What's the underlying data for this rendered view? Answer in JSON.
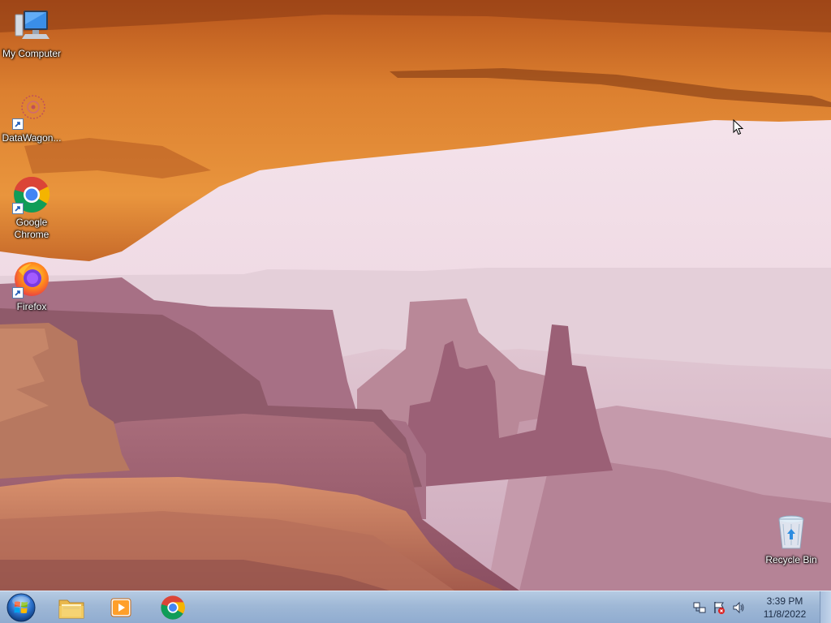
{
  "desktop": {
    "icons": [
      {
        "label": "My Computer",
        "icon": "computer-icon"
      },
      {
        "label": "DataWagon...",
        "icon": "datawagon-icon"
      },
      {
        "label": "Google Chrome",
        "icon": "chrome-icon"
      },
      {
        "label": "Firefox",
        "icon": "firefox-icon"
      },
      {
        "label": "Recycle Bin",
        "icon": "recycle-bin-icon"
      }
    ]
  },
  "taskbar": {
    "start_icon": "windows-start-icon",
    "pinned": [
      {
        "name": "Windows Explorer",
        "icon": "folder-icon"
      },
      {
        "name": "Windows Media Player",
        "icon": "media-player-icon"
      },
      {
        "name": "Google Chrome",
        "icon": "chrome-icon"
      }
    ],
    "tray": {
      "icons": [
        "network-icon",
        "action-center-icon",
        "volume-icon"
      ],
      "time": "3:39 PM",
      "date": "11/8/2022"
    }
  },
  "colors": {
    "taskbar": "#9fb8d6",
    "arch": "#d9762a",
    "sky": "#f1dde6"
  }
}
